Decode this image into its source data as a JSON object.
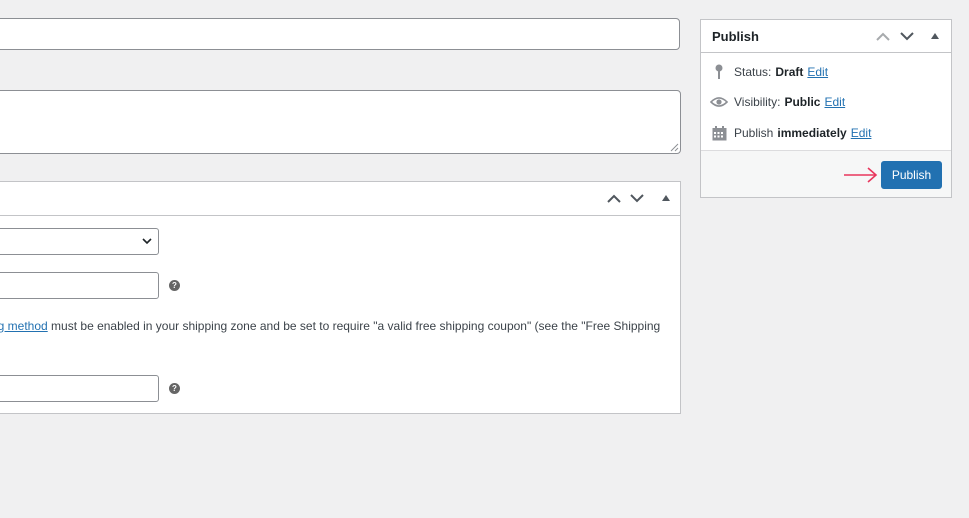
{
  "main": {
    "title_value": "",
    "description_value": "",
    "coupon_metabox": {
      "help_tip_glyph": "?",
      "description_link": "ng method",
      "description_rest": " must be enabled in your shipping zone and be set to require \"a valid free shipping coupon\" (see the \"Free Shipping"
    }
  },
  "publish": {
    "title": "Publish",
    "status_label": "Status:",
    "status_value": "Draft",
    "visibility_label": "Visibility:",
    "visibility_value": "Public",
    "schedule_label": "Publish",
    "schedule_value": "immediately",
    "edit_label": "Edit",
    "button_label": "Publish"
  },
  "colors": {
    "primary": "#2271b1",
    "annotation_arrow": "#e8365d",
    "background": "#f0f0f1"
  },
  "icons": [
    "chevron-up-icon",
    "chevron-down-icon",
    "triangle-up-icon",
    "pin-icon",
    "eye-icon",
    "calendar-icon",
    "help-icon",
    "arrow-right-icon"
  ]
}
